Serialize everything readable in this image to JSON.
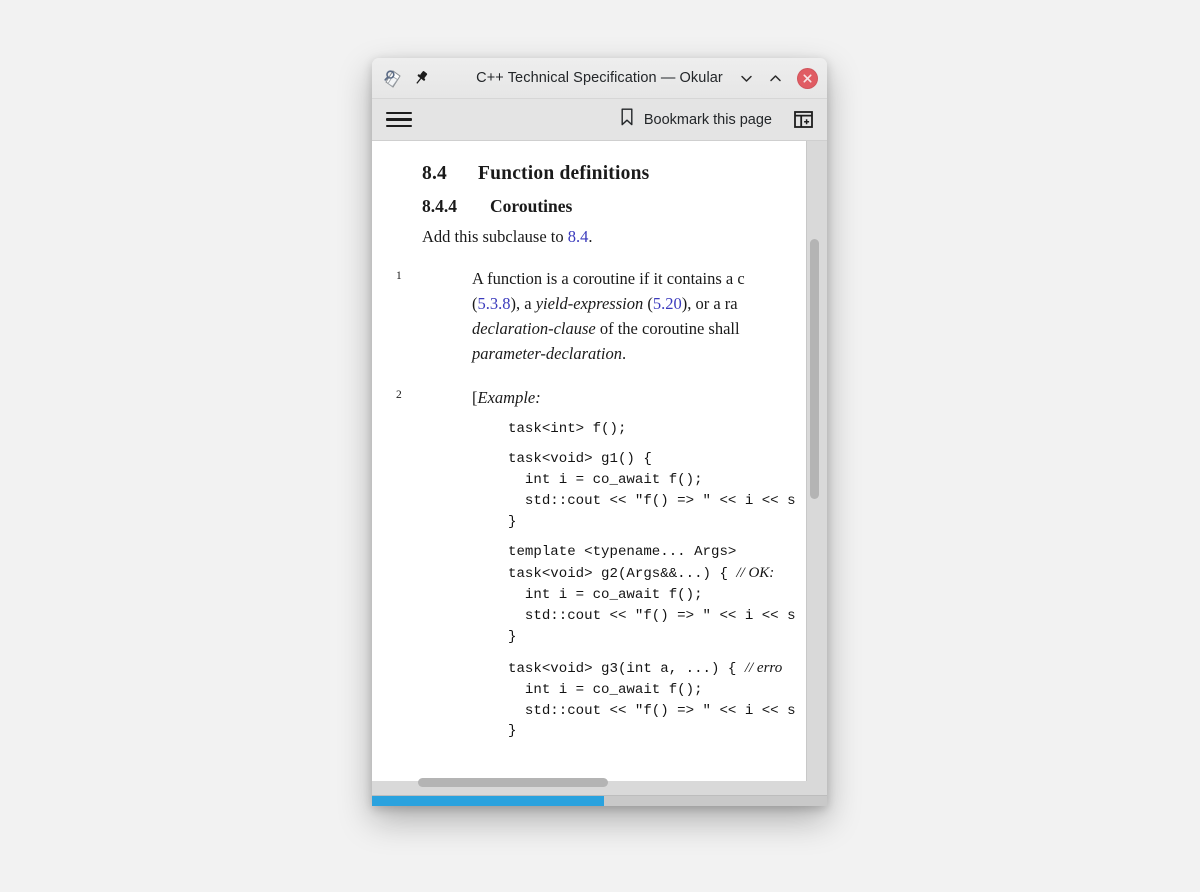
{
  "window": {
    "title": "C++ Technical Specification — Okular",
    "app_icon": "okular-document-magnifier-icon",
    "pin_icon": "pin-icon",
    "controls": {
      "minimize_icon": "chevron-down-icon",
      "maximize_icon": "chevron-up-icon",
      "close_icon": "close-icon",
      "close_color": "#e05c63"
    }
  },
  "toolbar": {
    "menu_icon": "hamburger-menu-icon",
    "bookmark_icon": "bookmark-ribbon-icon",
    "bookmark_label": "Bookmark this page",
    "sidebar_toggle_icon": "panel-add-icon"
  },
  "document": {
    "section": {
      "number": "8.4",
      "title": "Function definitions"
    },
    "subsection": {
      "number": "8.4.4",
      "title": "Coroutines"
    },
    "lead_in": {
      "prefix": "Add this subclause to ",
      "reference": "8.4",
      "suffix": "."
    },
    "paragraphs": [
      {
        "number": "1",
        "runs": [
          {
            "text": "A function is a ",
            "style": "normal"
          },
          {
            "text": "coroutine",
            "style": "italic"
          },
          {
            "text": " if it contains a ",
            "style": "normal"
          },
          {
            "text": "c",
            "style": "italic"
          },
          {
            "text": "\n(",
            "style": "normal"
          },
          {
            "text": "5.3.8",
            "style": "reference"
          },
          {
            "text": "), a ",
            "style": "normal"
          },
          {
            "text": "yield-expression",
            "style": "italic"
          },
          {
            "text": " (",
            "style": "normal"
          },
          {
            "text": "5.20",
            "style": "reference"
          },
          {
            "text": "), or a ra",
            "style": "normal"
          },
          {
            "text": "\ndeclaration-clause",
            "style": "italic"
          },
          {
            "text": " of the coroutine shall",
            "style": "normal"
          },
          {
            "text": "\nparameter-declaration",
            "style": "italic"
          },
          {
            "text": ".",
            "style": "normal"
          }
        ],
        "line1": "A function is a coroutine if it contains a c",
        "line2_a": "(",
        "line2_ref1": "5.3.8",
        "line2_b": "), a ",
        "line2_ital": "yield-expression",
        "line2_c": " (",
        "line2_ref2": "5.20",
        "line2_d": "), or a ra",
        "line3_ital": "declaration-clause",
        "line3_rest": " of the coroutine shall",
        "line4_ital": "parameter-declaration",
        "line4_rest": "."
      },
      {
        "number": "2",
        "example_bracket": "[",
        "example_word": "Example:"
      }
    ],
    "code_blocks": [
      {
        "id": "code-f",
        "lines": [
          "task<int> f();"
        ]
      },
      {
        "id": "code-g1",
        "lines": [
          "task<void> g1() {",
          "  int i = co_await f();",
          "  std::cout << \"f() => \" << i << s",
          "}"
        ]
      },
      {
        "id": "code-g2",
        "head": "template <typename... Args>",
        "signature": "task<void> g2(Args&&...) { ",
        "comment": "// OK:",
        "lines": [
          "  int i = co_await f();",
          "  std::cout << \"f() => \" << i << s",
          "}"
        ]
      },
      {
        "id": "code-g3",
        "signature": "task<void> g3(int a, ...) { ",
        "comment": "// erro",
        "lines": [
          "  int i = co_await f();",
          "  std::cout << \"f() => \" << i << s",
          "}"
        ]
      }
    ]
  },
  "scrollbars": {
    "vertical_name": "document-vertical-scrollbar",
    "horizontal_name": "document-horizontal-scrollbar"
  },
  "status": {
    "progress_color": "#2aa2de",
    "progress_percent": 51
  }
}
